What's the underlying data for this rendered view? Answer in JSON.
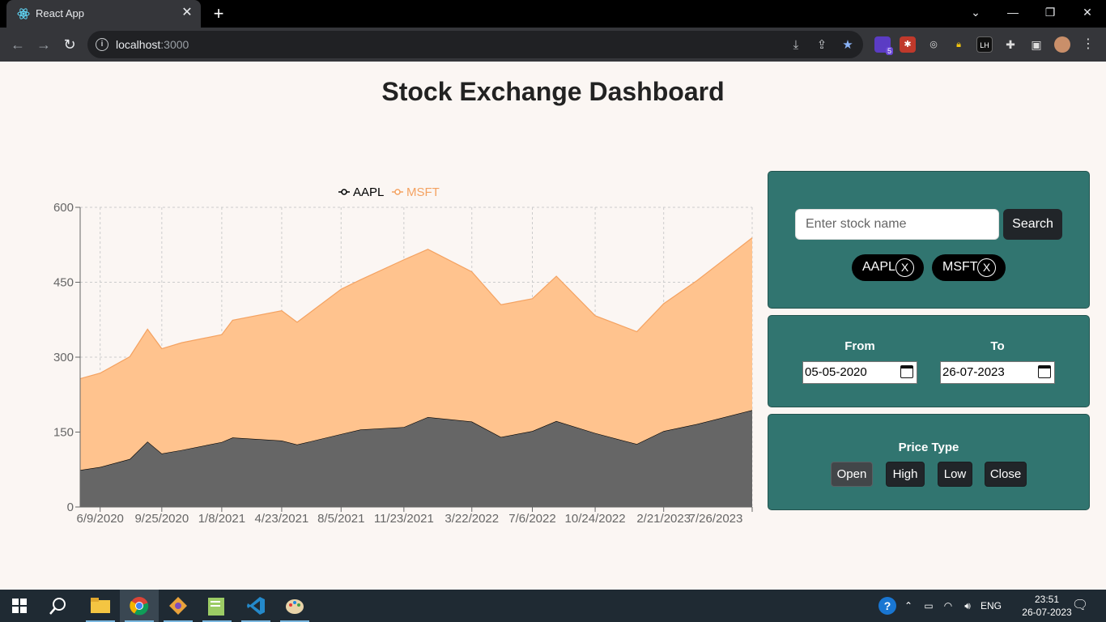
{
  "browser": {
    "tab_title": "React App",
    "url_host": "localhost",
    "url_port": ":3000",
    "extension_badge": "5",
    "extension_lh": "LH"
  },
  "page": {
    "title": "Stock Exchange Dashboard"
  },
  "search": {
    "placeholder": "Enter stock name",
    "button_label": "Search",
    "selected": [
      {
        "symbol": "AAPL",
        "remove": "X"
      },
      {
        "symbol": "MSFT",
        "remove": "X"
      }
    ]
  },
  "dates": {
    "from_label": "From",
    "from_value": "05-05-2020",
    "to_label": "To",
    "to_value": "26-07-2023"
  },
  "price_type": {
    "label": "Price Type",
    "options": [
      "Open",
      "High",
      "Low",
      "Close"
    ],
    "active": "Open"
  },
  "taskbar": {
    "language": "ENG",
    "time": "23:51",
    "date": "26-07-2023"
  },
  "chart_data": {
    "type": "area",
    "stacked": true,
    "x_tick_labels": [
      "6/9/2020",
      "9/25/2020",
      "1/8/2021",
      "4/23/2021",
      "8/5/2021",
      "11/23/2021",
      "3/22/2022",
      "7/6/2022",
      "10/24/2022",
      "2/21/2023",
      "7/26/2023"
    ],
    "x_range": [
      "5/5/2020",
      "7/26/2023"
    ],
    "ylim": [
      0,
      600
    ],
    "y_ticks": [
      0,
      150,
      300,
      450,
      600
    ],
    "grid": true,
    "legend_position": "top-center",
    "series": [
      {
        "name": "AAPL",
        "color": "#000000",
        "fill": "#666666",
        "x": [
          "5/5/2020",
          "6/9/2020",
          "7/31/2020",
          "8/31/2020",
          "9/25/2020",
          "10/30/2020",
          "1/8/2021",
          "1/27/2021",
          "4/23/2021",
          "5/20/2021",
          "8/5/2021",
          "9/8/2021",
          "11/23/2021",
          "1/4/2022",
          "3/22/2022",
          "5/12/2022",
          "7/6/2022",
          "8/17/2022",
          "10/24/2022",
          "1/5/2023",
          "2/21/2023",
          "4/20/2023",
          "7/26/2023"
        ],
        "values": [
          74,
          80,
          96,
          131,
          107,
          114,
          130,
          139,
          133,
          125,
          146,
          155,
          160,
          180,
          171,
          140,
          152,
          172,
          148,
          126,
          152,
          166,
          194
        ]
      },
      {
        "name": "MSFT",
        "color": "#f4a261",
        "fill": "#ffc38e",
        "x": [
          "5/5/2020",
          "6/9/2020",
          "7/31/2020",
          "8/31/2020",
          "9/25/2020",
          "10/30/2020",
          "1/8/2021",
          "1/27/2021",
          "4/23/2021",
          "5/20/2021",
          "8/5/2021",
          "9/8/2021",
          "11/23/2021",
          "1/4/2022",
          "3/22/2022",
          "5/12/2022",
          "7/6/2022",
          "8/17/2022",
          "10/24/2022",
          "1/5/2023",
          "2/21/2023",
          "4/20/2023",
          "7/26/2023"
        ],
        "values": [
          183,
          188,
          205,
          225,
          210,
          215,
          215,
          235,
          260,
          245,
          290,
          300,
          335,
          336,
          300,
          265,
          265,
          290,
          235,
          225,
          255,
          287,
          345
        ]
      }
    ]
  }
}
